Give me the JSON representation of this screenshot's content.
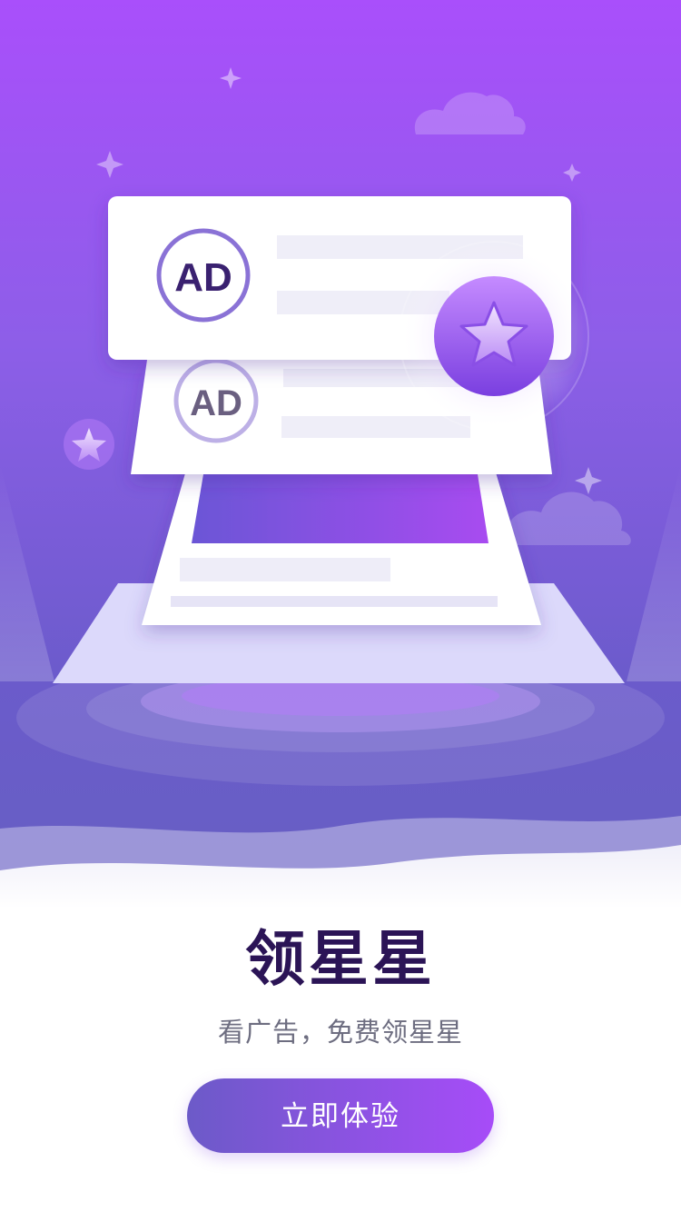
{
  "illustration": {
    "ad_badge_front": "AD",
    "ad_badge_back": "AD",
    "star_icon": "star-icon",
    "cloud_icon": "cloud-icon"
  },
  "content": {
    "title": "领星星",
    "subtitle": "看广告，免费领星星",
    "cta_label": "立即体验"
  },
  "colors": {
    "accent_start": "#6c5ac8",
    "accent_end": "#a74cf8",
    "hero_top": "#a94ffb",
    "hero_bottom": "#6660c2",
    "title_color": "#2b1456"
  }
}
